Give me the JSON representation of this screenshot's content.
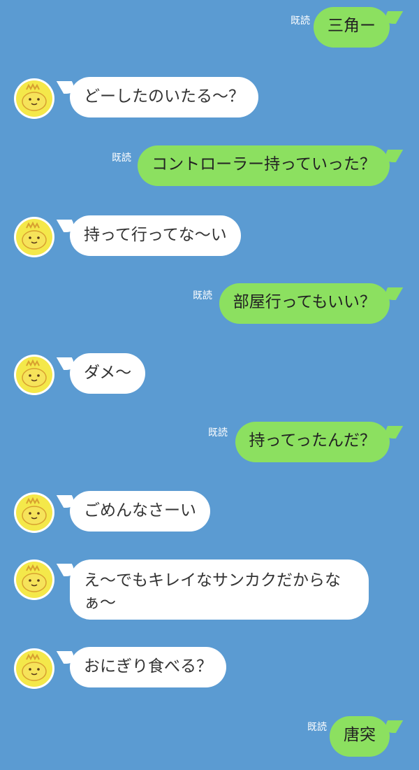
{
  "colors": {
    "background": "#5b9bd2",
    "sent_bubble": "#8ce060",
    "received_bubble": "#ffffff",
    "read_label": "#ffffff"
  },
  "avatar_icon": "yellow-character-avatar",
  "messages": [
    {
      "type": "sent",
      "text": "三角ー",
      "read": "既読"
    },
    {
      "type": "received",
      "text": "どーしたのいたる〜？"
    },
    {
      "type": "sent",
      "text": "コントローラー持っていった？",
      "read": "既読"
    },
    {
      "type": "received",
      "text": "持って行ってな〜い"
    },
    {
      "type": "sent",
      "text": "部屋行ってもいい？",
      "read": "既読"
    },
    {
      "type": "received",
      "text": "ダメ〜"
    },
    {
      "type": "sent",
      "text": "持ってったんだ？",
      "read": "既読"
    },
    {
      "type": "received",
      "text": "ごめんなさーい"
    },
    {
      "type": "received",
      "text": "え〜でもキレイなサンカクだからなぁ〜"
    },
    {
      "type": "received",
      "text": "おにぎり食べる？"
    },
    {
      "type": "sent",
      "text": "唐突",
      "read": "既読"
    }
  ]
}
